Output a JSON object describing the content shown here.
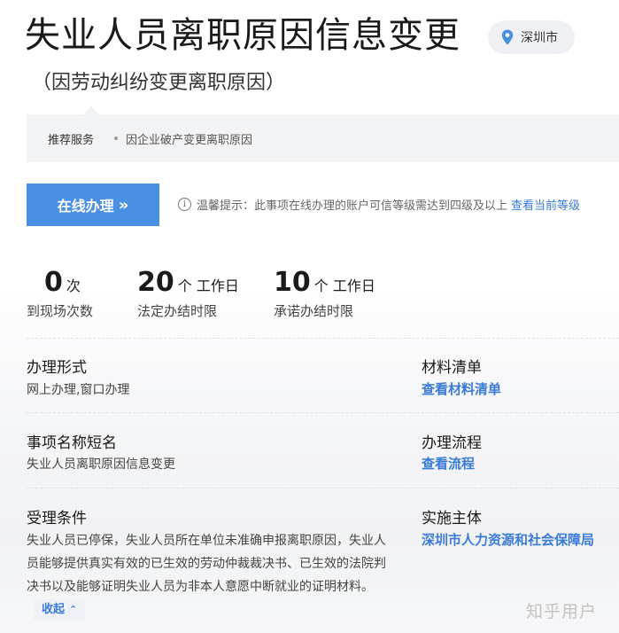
{
  "header": {
    "title": "失业人员离职原因信息变更",
    "subtitle": "（因劳动纠纷变更离职原因）",
    "city": "深圳市"
  },
  "recommend": {
    "label": "推荐服务",
    "item": "因企业破产变更离职原因"
  },
  "actions": {
    "online_button": "在线办理",
    "online_chevron": "»",
    "tip_prefix": "温馨提示：此事项在线办理的账户可信等级需达到四级及以上",
    "tip_link": "查看当前等级"
  },
  "stats": [
    {
      "number": "0",
      "unit": "次",
      "desc": "到现场次数"
    },
    {
      "number": "20",
      "unit": "个 工作日",
      "desc": "法定办结时限"
    },
    {
      "number": "10",
      "unit": "个 工作日",
      "desc": "承诺办结时限"
    }
  ],
  "fields": {
    "form": {
      "title": "办理形式",
      "value": "网上办理,窗口办理"
    },
    "materials": {
      "title": "材料清单",
      "link": "查看材料清单"
    },
    "short_name": {
      "title": "事项名称短名",
      "value": "失业人员离职原因信息变更"
    },
    "process": {
      "title": "办理流程",
      "link": "查看流程"
    },
    "conditions": {
      "title": "受理条件",
      "value": "失业人员已停保，失业人员所在单位未准确申报离职原因，失业人员能够提供真实有效的已生效的劳动仲裁裁决书、已生效的法院判决书以及能够证明失业人员为非本人意愿中断就业的证明材料。",
      "collapse_label": "收起"
    },
    "authority": {
      "title": "实施主体",
      "link": "深圳市人力资源和社会保障局"
    }
  },
  "watermark": "知乎用户",
  "colors": {
    "primary": "#4a90e2",
    "link": "#3a7ad9"
  }
}
